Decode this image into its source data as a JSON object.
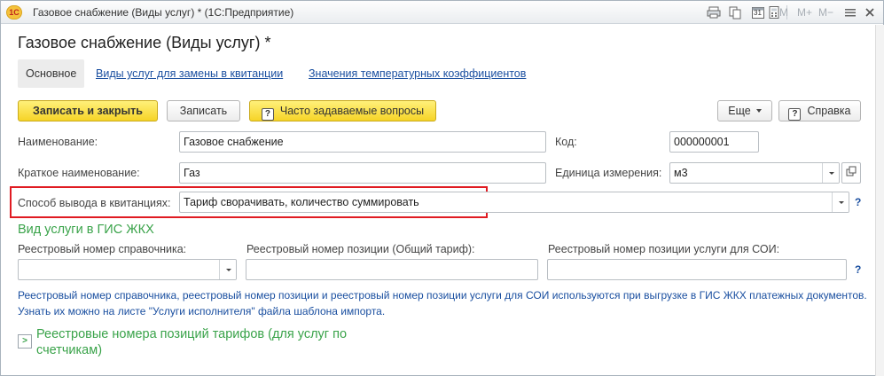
{
  "window": {
    "title": "Газовое снабжение (Виды услуг) * (1С:Предприятие)",
    "logo_text": "1С",
    "toolbar_icons": [
      "printer-icon",
      "copy-icon",
      "calendar-icon",
      "calculator-icon"
    ],
    "calendar_day": "31",
    "m_buttons": [
      "M",
      "M+",
      "M−"
    ]
  },
  "form": {
    "title": "Газовое снабжение (Виды услуг) *"
  },
  "tabs": [
    {
      "label": "Основное",
      "active": true
    },
    {
      "label": "Виды услуг для замены в квитанции",
      "active": false
    },
    {
      "label": "Значения температурных коэффициентов",
      "active": false
    }
  ],
  "command_bar": {
    "save_close": "Записать и закрыть",
    "save": "Записать",
    "faq_icon": "?",
    "faq": "Часто задаваемые вопросы",
    "more": "Еще",
    "help_icon": "?",
    "help": "Справка"
  },
  "fields": {
    "name_label": "Наименование:",
    "name_value": "Газовое снабжение",
    "code_label": "Код:",
    "code_value": "000000001",
    "short_name_label": "Краткое наименование:",
    "short_name_value": "Газ",
    "unit_label": "Единица измерения:",
    "unit_value": "м3",
    "output_method_label": "Способ вывода в квитанциях:",
    "output_method_value": "Тариф сворачивать, количество суммировать",
    "hint": "?"
  },
  "gis": {
    "section_title": "Вид услуги в ГИС ЖКХ",
    "registry_ref_label": "Реестровый номер справочника:",
    "registry_ref_value": "",
    "registry_pos_label": "Реестровый номер позиции (Общий тариф):",
    "registry_pos_value": "",
    "registry_soi_label": "Реестровый номер позиции услуги для СОИ:",
    "registry_soi_value": "",
    "hint": "?",
    "note": "Реестровый номер справочника, реестровый номер позиции и реестровый номер позиции услуги для СОИ используются при выгрузке в ГИС ЖКХ платежных документов. Узнать их можно на листе \"Услуги исполнителя\" файла шаблона импорта."
  },
  "tariffs_group": {
    "expander": ">",
    "title": "Реестровые номера позиций тарифов (для услуг по счетчикам)"
  },
  "colors": {
    "accent_yellow": "#f6d427",
    "link_blue": "#1a4fa0",
    "section_green": "#3aa34a",
    "highlight_red": "#e01b22"
  }
}
